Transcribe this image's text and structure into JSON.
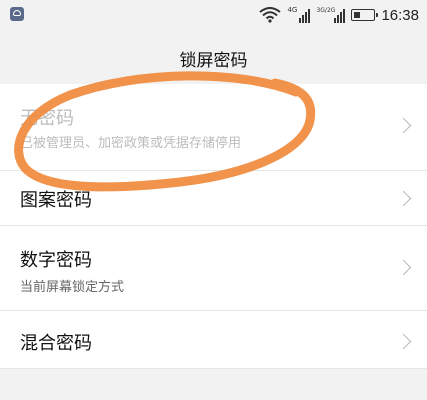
{
  "status_bar": {
    "time": "16:38",
    "signal1_label": "4G",
    "signal2_label": "3G/2G",
    "icons": [
      "app-notification-icon",
      "wifi-icon",
      "cellular-signal-icon",
      "cellular-signal-icon",
      "battery-icon"
    ]
  },
  "header": {
    "title": "锁屏密码"
  },
  "list": {
    "items": [
      {
        "label": "无密码",
        "sub": "已被管理员、加密政策或凭据存储停用",
        "enabled": false
      },
      {
        "label": "图案密码",
        "sub": "",
        "enabled": true
      },
      {
        "label": "数字密码",
        "sub": "当前屏幕锁定方式",
        "enabled": true
      },
      {
        "label": "混合密码",
        "sub": "",
        "enabled": true
      }
    ]
  },
  "annotation": {
    "color": "#f08a3c"
  }
}
